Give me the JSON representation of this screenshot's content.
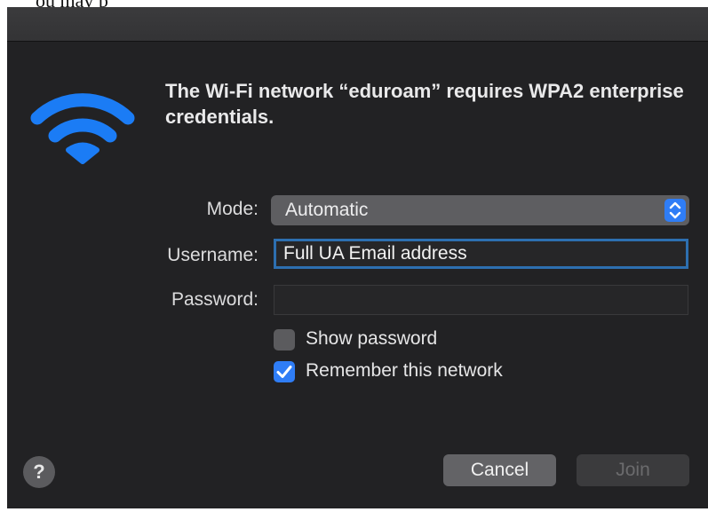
{
  "page_fragment": "ou may p",
  "dialog": {
    "message": "The Wi-Fi network “eduroam” requires WPA2 enterprise credentials.",
    "wifi_icon_color": "#1b7cf5",
    "mode": {
      "label": "Mode:",
      "value": "Automatic"
    },
    "username": {
      "label": "Username:",
      "value": "Full UA Email address"
    },
    "password": {
      "label": "Password:",
      "value": ""
    },
    "show_password": {
      "label": "Show password",
      "checked": false
    },
    "remember_network": {
      "label": "Remember this network",
      "checked": true
    },
    "help_label": "?",
    "cancel_label": "Cancel",
    "join_label": "Join",
    "accent_color": "#2f7df6"
  }
}
